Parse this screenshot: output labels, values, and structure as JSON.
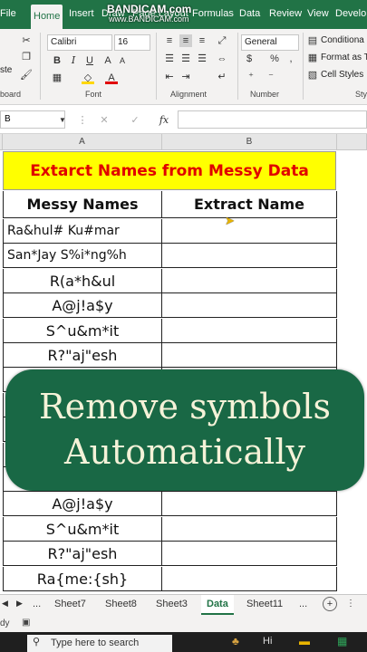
{
  "tabs": [
    "File",
    "Home",
    "Insert",
    "Draw",
    "Page Layout",
    "Formulas",
    "Data",
    "Review",
    "View",
    "Develop"
  ],
  "watermark": {
    "main": "BANDICAM.com",
    "sub": "www.BANDICAM.com"
  },
  "ribbon": {
    "font_name": "Calibri",
    "font_size": "16",
    "number_format": "General",
    "paste_label": "ste",
    "conditional": "Conditiona",
    "format_as": "Format as T",
    "cell_styles": "Cell Styles",
    "groups": {
      "clipboard": "board",
      "font": "Font",
      "alignment": "Alignment",
      "number": "Number",
      "styles": "Sty"
    }
  },
  "formula_bar": {
    "name_box": "B",
    "fx": "fx"
  },
  "columns": [
    "A",
    "B"
  ],
  "sheet": {
    "title": "Extarct Names from Messy Data",
    "header_a": "Messy Names",
    "header_b": "Extract Name",
    "rows": [
      "Ra&hul# Ku#mar",
      "San*Jay S%i*ng%h",
      "R(a*h&ul",
      "A@j!a$y",
      "S^u&m*it",
      "R?\"aj\"esh",
      "",
      "",
      "",
      "",
      "",
      "A@j!a$y",
      "S^u&m*it",
      "R?\"aj\"esh",
      "Ra{me:{sh}"
    ]
  },
  "overlay": {
    "line1": "Remove symbols",
    "line2": "Automatically"
  },
  "sheet_tabs": {
    "nav_prev": "◀",
    "nav_next": "▶",
    "ellipsis": "...",
    "tabs": [
      "Sheet7",
      "Sheet8",
      "Sheet3",
      "Data",
      "Sheet11"
    ],
    "active": "Data",
    "add": "+"
  },
  "status": {
    "text": "dy"
  },
  "taskbar": {
    "search_placeholder": "Type here to search",
    "tray": "Hi"
  }
}
